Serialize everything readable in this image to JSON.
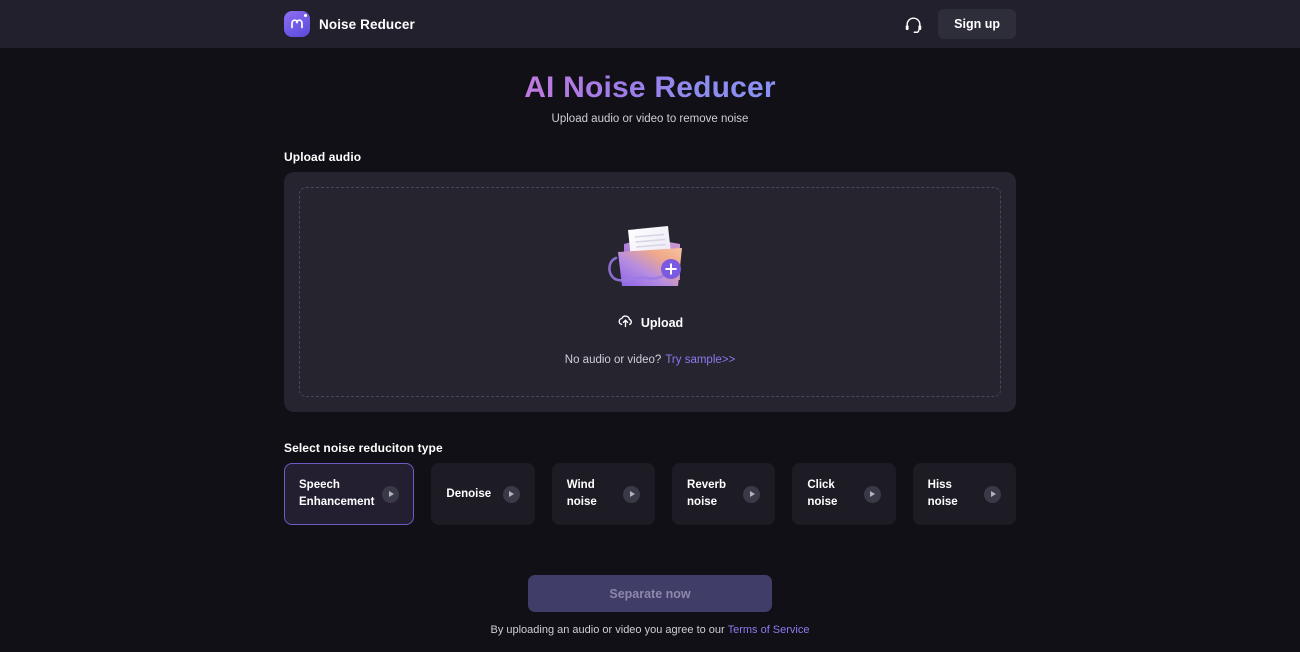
{
  "header": {
    "brand_name": "Noise Reducer",
    "logo_icon": "m-logo-icon",
    "support_icon": "headset-icon",
    "signup_label": "Sign up"
  },
  "hero": {
    "title": "AI Noise Reducer",
    "subtitle": "Upload audio or video to remove noise",
    "title_gradient_from": "#c07adf",
    "title_gradient_to": "#8a91f2"
  },
  "upload": {
    "section_label": "Upload audio",
    "illustration_icon": "folder-add-illustration",
    "upload_icon": "cloud-upload-icon",
    "upload_label": "Upload",
    "hint_text": "No audio or video?",
    "sample_link": "Try sample>>"
  },
  "noise_types": {
    "section_label": "Select noise reduciton type",
    "play_icon": "play-icon",
    "selected_index": 0,
    "selected_border_color": "#6d5cc6",
    "items": [
      {
        "label": "Speech Enhancement",
        "selected": true
      },
      {
        "label": "Denoise",
        "selected": false
      },
      {
        "label": "Wind noise",
        "selected": false
      },
      {
        "label": "Reverb noise",
        "selected": false
      },
      {
        "label": "Click noise",
        "selected": false
      },
      {
        "label": "Hiss noise",
        "selected": false
      }
    ]
  },
  "footer": {
    "cta_label": "Separate now",
    "cta_disabled": true,
    "cta_color": "#403d68",
    "terms_prefix": "By uploading an audio or video you agree to our ",
    "terms_link": "Terms of Service"
  }
}
